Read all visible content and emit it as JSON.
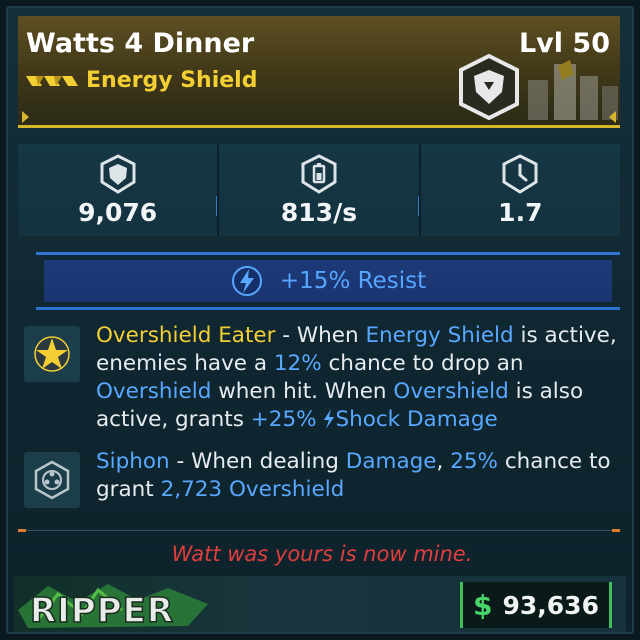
{
  "item": {
    "name": "Watts 4 Dinner",
    "level": "Lvl 50",
    "type": "Energy Shield",
    "rarity_icon": "legendary-chevrons-icon",
    "type_icon": "shield-badge-icon",
    "rarity_color": "#f3cf33"
  },
  "stats": [
    {
      "icon": "shield-capacity-icon",
      "value": "9,076"
    },
    {
      "icon": "recharge-rate-icon",
      "value": "813/s"
    },
    {
      "icon": "recharge-delay-icon",
      "value": "1.7"
    }
  ],
  "resist": {
    "icon": "shock-bolt-icon",
    "text": "+15% Resist",
    "color": "#58a8ff"
  },
  "perks": [
    {
      "icon": "star-burst-icon",
      "name": "Overshield Eater",
      "t1": " - When ",
      "k1": "Energy Shield",
      "t2": " is active, enemies have a ",
      "k2": "12%",
      "t3": " chance to drop an ",
      "k3": "Overshield",
      "t4": " when hit. When ",
      "k4": "Overshield",
      "t5": " is also active, grants ",
      "k5": "+25%",
      "k6": "Shock Damage"
    },
    {
      "icon": "hex-siphon-icon",
      "name": "Siphon",
      "t1": " - When dealing ",
      "k1": "Damage",
      "t2": ", ",
      "k2": "25%",
      "t3": " chance to grant ",
      "k3": "2,723 Overshield"
    }
  ],
  "flavor": "Watt was yours is now mine.",
  "manufacturer": {
    "logo_text": "RIPPER",
    "logo_icon": "ripper-logo"
  },
  "price": {
    "currency": "$",
    "value": "93,636",
    "color": "#49d46a"
  }
}
